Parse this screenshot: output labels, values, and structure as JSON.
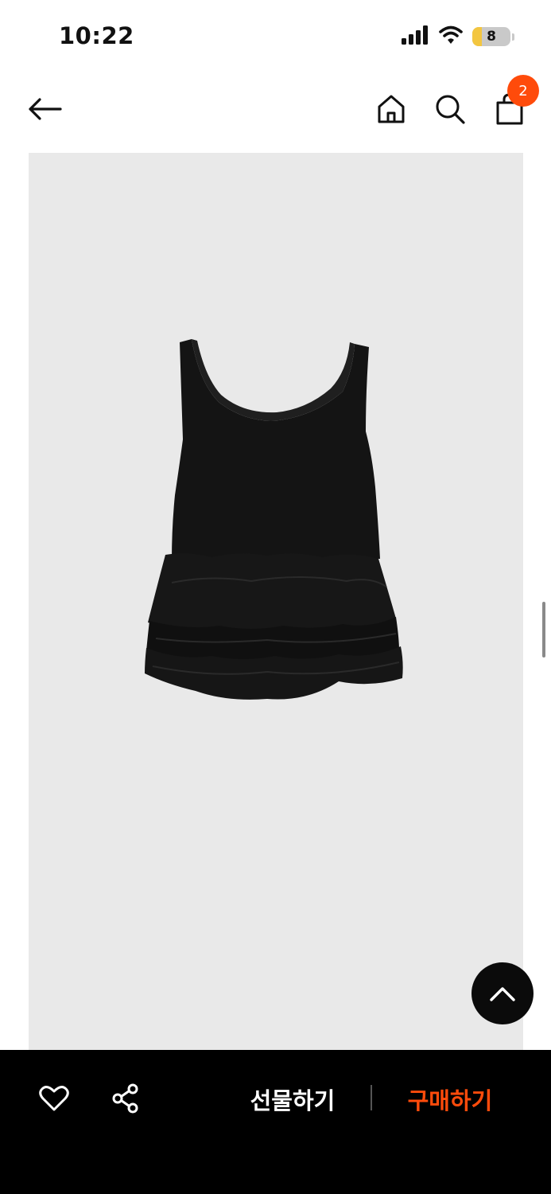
{
  "status_bar": {
    "time": "10:22",
    "battery_level": "8",
    "icons": [
      "signal-icon",
      "wifi-icon",
      "battery-icon"
    ]
  },
  "header": {
    "icons": [
      "back-arrow-icon",
      "home-icon",
      "search-icon",
      "shopping-bag-icon"
    ],
    "cart_count": "2"
  },
  "product": {
    "image": "black-ruffle-tiered-sleeveless-top"
  },
  "bottom_bar": {
    "gift_label": "선물하기",
    "buy_label": "구매하기",
    "icons": [
      "heart-icon",
      "share-icon"
    ]
  },
  "colors": {
    "accent": "#ff4b0b",
    "bottom_bar_bg": "#000000",
    "image_bg": "#e9e9e9",
    "top_button_bg": "#0b0b0b"
  }
}
